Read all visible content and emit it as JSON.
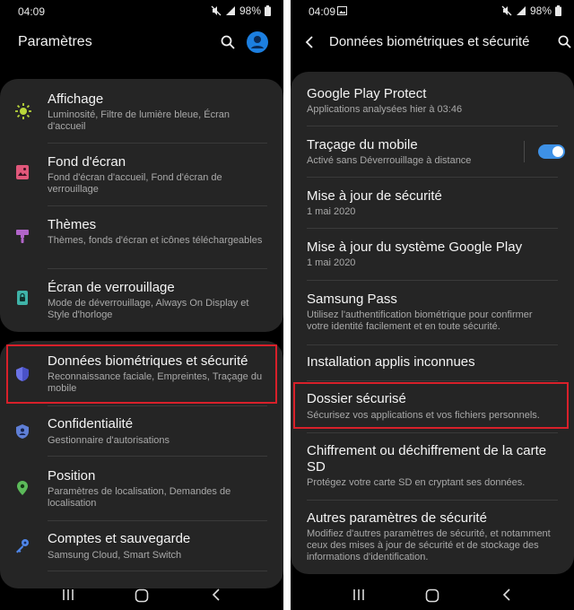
{
  "colors": {
    "background": "#000000",
    "card": "#252525",
    "accent_toggle": "#3e91e6",
    "highlight_border": "#d8202a"
  },
  "left": {
    "status": {
      "time": "04:09",
      "battery": "98%"
    },
    "title": "Paramètres",
    "card1": [
      {
        "label": "Affichage",
        "desc": "Luminosité, Filtre de lumière bleue, Écran d'accueil",
        "icon": "sun-icon"
      },
      {
        "label": "Fond d'écran",
        "desc": "Fond d'écran d'accueil, Fond d'écran de verrouillage",
        "icon": "wallpaper-icon"
      },
      {
        "label": "Thèmes",
        "desc": "Thèmes, fonds d'écran et icônes téléchargeables",
        "icon": "paint-brush-icon"
      },
      {
        "label": "Écran de verrouillage",
        "desc": "Mode de déverrouillage, Always On Display et Style d'horloge",
        "icon": "lock-icon"
      }
    ],
    "card2": [
      {
        "label": "Données biométriques et sécurité",
        "desc": "Reconnaissance faciale, Empreintes, Traçage du mobile",
        "icon": "shield-icon"
      },
      {
        "label": "Confidentialité",
        "desc": "Gestionnaire d'autorisations",
        "icon": "privacy-shield-icon"
      },
      {
        "label": "Position",
        "desc": "Paramètres de localisation, Demandes de localisation",
        "icon": "location-pin-icon"
      },
      {
        "label": "Comptes et sauvegarde",
        "desc": "Samsung Cloud, Smart Switch",
        "icon": "key-icon"
      }
    ]
  },
  "right": {
    "status": {
      "time": "04:09",
      "battery": "98%"
    },
    "title": "Données biométriques et sécurité",
    "items": [
      {
        "label": "Google Play Protect",
        "desc": "Applications analysées hier à 03:46"
      },
      {
        "label": "Traçage du mobile",
        "desc": "Activé sans Déverrouillage à distance",
        "toggle": true
      },
      {
        "label": "Mise à jour de sécurité",
        "desc": "1 mai 2020"
      },
      {
        "label": "Mise à jour du système Google Play",
        "desc": "1 mai 2020"
      },
      {
        "label": "Samsung Pass",
        "desc": "Utilisez l'authentification biométrique pour confirmer votre identité facilement et en toute sécurité."
      },
      {
        "label": "Installation applis inconnues",
        "desc": ""
      },
      {
        "label": "Dossier sécurisé",
        "desc": "Sécurisez vos applications et vos fichiers personnels."
      },
      {
        "label": "Chiffrement ou déchiffrement de la carte SD",
        "desc": "Protégez votre carte SD en cryptant ses données."
      },
      {
        "label": "Autres paramètres de sécurité",
        "desc": "Modifiez d'autres paramètres de sécurité, et notamment ceux des mises à jour de sécurité et de stockage des informations d'identification."
      }
    ]
  }
}
